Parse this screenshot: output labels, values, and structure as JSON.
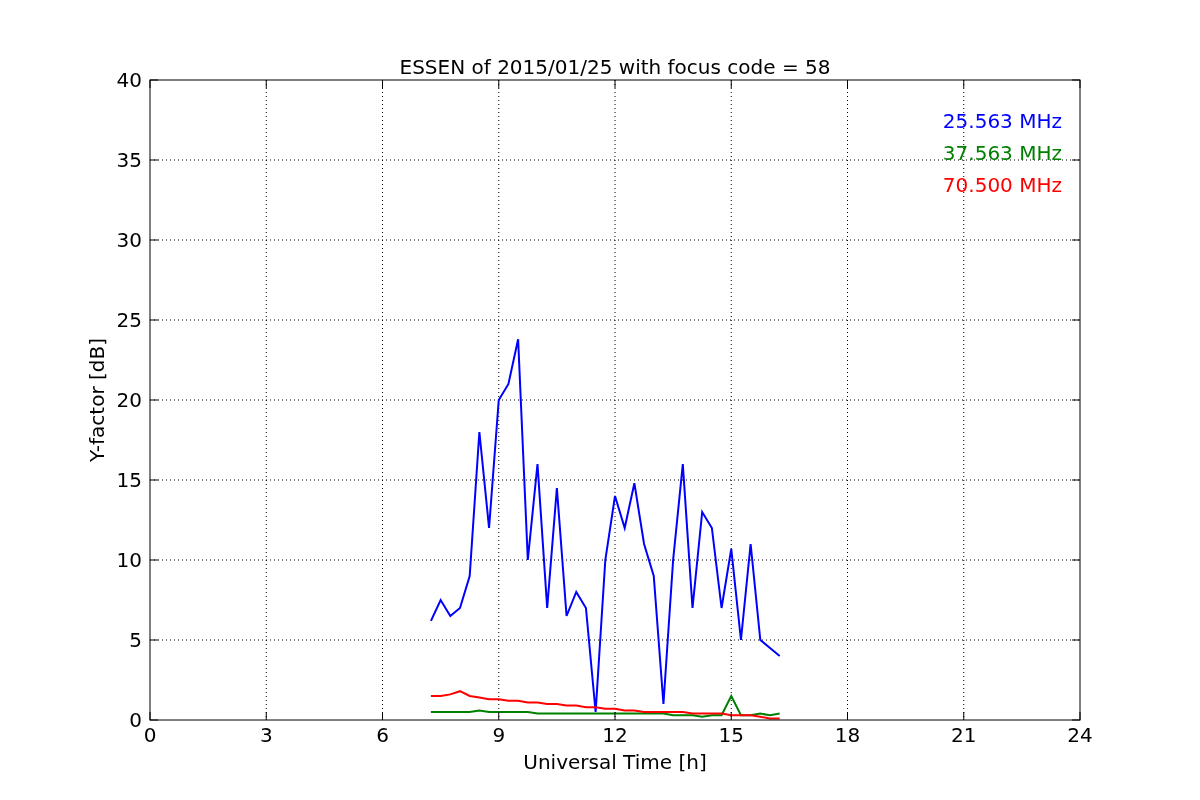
{
  "figure": {
    "chart_data": {
      "type": "line",
      "grid": true,
      "title": "ESSEN of 2015/01/25 with focus code = 58",
      "xlabel": "Universal Time [h]",
      "ylabel": "Y-factor [dB]",
      "xlim": [
        0,
        24
      ],
      "ylim": [
        0,
        40
      ],
      "xticks": [
        0,
        3,
        6,
        9,
        12,
        15,
        18,
        21,
        24
      ],
      "yticks": [
        0,
        5,
        10,
        15,
        20,
        25,
        30,
        35,
        40
      ],
      "x": [
        7.25,
        7.5,
        7.75,
        8.0,
        8.25,
        8.5,
        8.75,
        9.0,
        9.25,
        9.5,
        9.75,
        10.0,
        10.25,
        10.5,
        10.75,
        11.0,
        11.25,
        11.5,
        11.75,
        12.0,
        12.25,
        12.5,
        12.75,
        13.0,
        13.25,
        13.5,
        13.75,
        14.0,
        14.25,
        14.5,
        14.75,
        15.0,
        15.25,
        15.5,
        15.75,
        16.0,
        16.25
      ],
      "series": [
        {
          "name": "25.563 MHz",
          "color": "#0000ff",
          "values": [
            6.2,
            7.5,
            6.5,
            7.0,
            9.0,
            18.0,
            12.0,
            20.0,
            21.0,
            23.8,
            10.0,
            16.0,
            7.0,
            14.5,
            6.5,
            8.0,
            7.0,
            0.5,
            10.0,
            14.0,
            12.0,
            14.8,
            11.0,
            9.0,
            1.0,
            10.0,
            16.0,
            7.0,
            13.0,
            12.0,
            7.0,
            10.7,
            5.0,
            11.0,
            5.0,
            4.5,
            4.0
          ]
        },
        {
          "name": "37.563 MHz",
          "color": "#008000",
          "values": [
            0.5,
            0.5,
            0.5,
            0.5,
            0.5,
            0.6,
            0.5,
            0.5,
            0.5,
            0.5,
            0.5,
            0.4,
            0.4,
            0.4,
            0.4,
            0.4,
            0.4,
            0.4,
            0.4,
            0.4,
            0.4,
            0.4,
            0.4,
            0.4,
            0.4,
            0.3,
            0.3,
            0.3,
            0.2,
            0.3,
            0.3,
            1.5,
            0.3,
            0.3,
            0.4,
            0.3,
            0.4
          ]
        },
        {
          "name": "70.500 MHz",
          "color": "#ff0000",
          "values": [
            1.5,
            1.5,
            1.6,
            1.8,
            1.5,
            1.4,
            1.3,
            1.3,
            1.2,
            1.2,
            1.1,
            1.1,
            1.0,
            1.0,
            0.9,
            0.9,
            0.8,
            0.8,
            0.7,
            0.7,
            0.6,
            0.6,
            0.5,
            0.5,
            0.5,
            0.5,
            0.5,
            0.4,
            0.4,
            0.4,
            0.4,
            0.3,
            0.3,
            0.3,
            0.2,
            0.1,
            0.1
          ]
        }
      ]
    }
  }
}
